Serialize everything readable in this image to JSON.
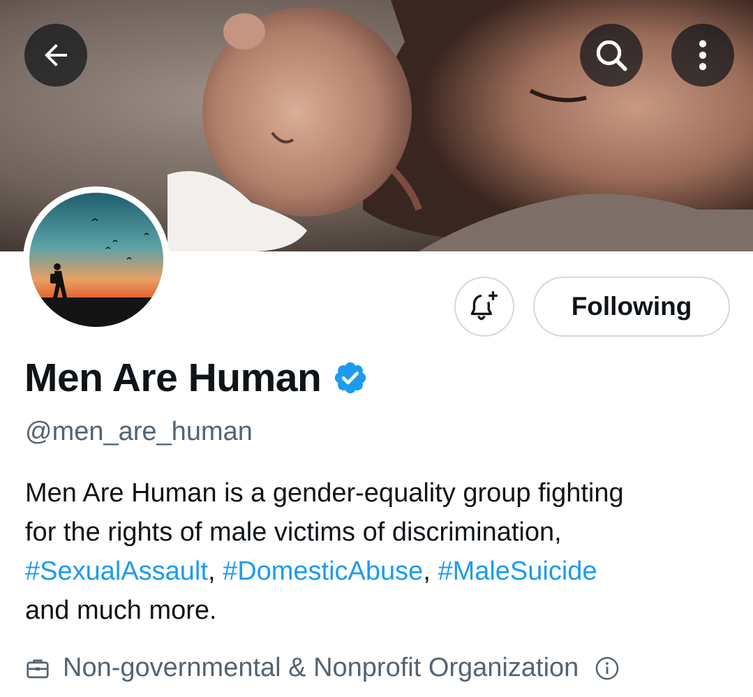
{
  "header": {
    "back_icon": "arrow-left-icon",
    "search_icon": "search-icon",
    "more_icon": "more-vertical-icon"
  },
  "actions": {
    "notify_icon": "bell-plus-icon",
    "following_label": "Following"
  },
  "profile": {
    "display_name": "Men Are Human",
    "verified_icon": "verified-badge-icon",
    "handle": "@men_are_human",
    "bio": {
      "line1": "Men Are Human is a gender-equality group fighting",
      "line2": "for the rights of male victims of discrimination,",
      "hashtag1": "#SexualAssault",
      "sep1": ", ",
      "hashtag2": "#DomesticAbuse",
      "sep2": ", ",
      "hashtag3": "#MaleSuicide",
      "line4": "and much more."
    },
    "category_icon": "briefcase-icon",
    "category": "Non-governmental & Nonprofit Organization",
    "info_icon": "info-icon"
  },
  "colors": {
    "accent": "#1d9bf0",
    "text_primary": "#0f1419",
    "text_secondary": "#536471",
    "border": "#cfd9de"
  }
}
